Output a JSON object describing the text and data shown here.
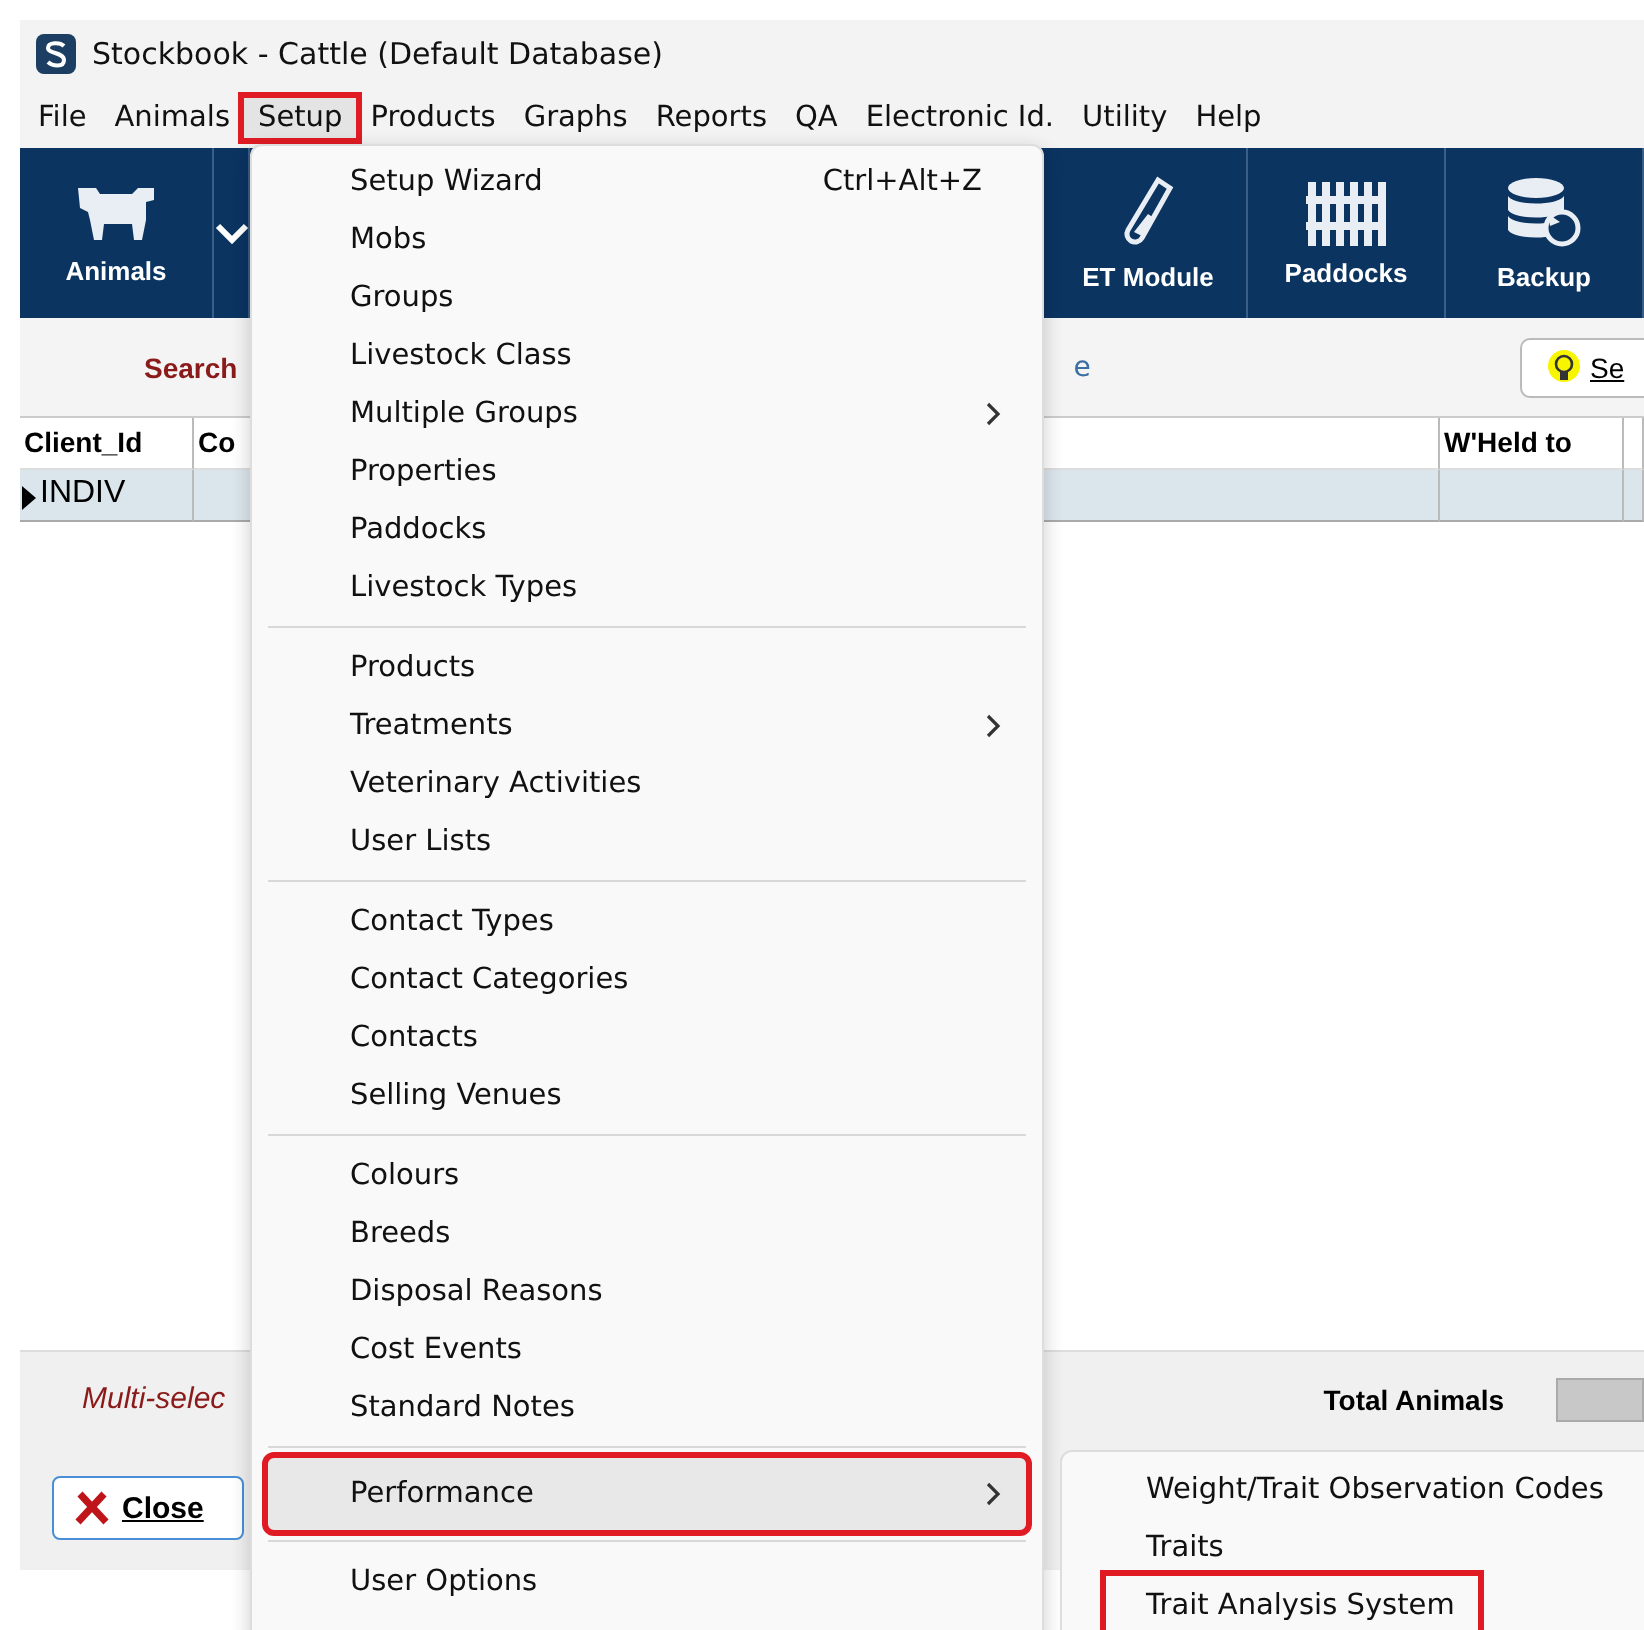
{
  "window": {
    "title": "Stockbook - Cattle (Default Database)"
  },
  "menubar": [
    {
      "label": "File",
      "selected": false,
      "annotated": false
    },
    {
      "label": "Animals",
      "selected": false,
      "annotated": false
    },
    {
      "label": "Setup",
      "selected": true,
      "annotated": true
    },
    {
      "label": "Products",
      "selected": false,
      "annotated": false
    },
    {
      "label": "Graphs",
      "selected": false,
      "annotated": false
    },
    {
      "label": "Reports",
      "selected": false,
      "annotated": false
    },
    {
      "label": "QA",
      "selected": false,
      "annotated": false
    },
    {
      "label": "Electronic Id.",
      "selected": false,
      "annotated": false
    },
    {
      "label": "Utility",
      "selected": false,
      "annotated": false
    },
    {
      "label": "Help",
      "selected": false,
      "annotated": false
    }
  ],
  "toolbar": [
    {
      "label": "Animals"
    },
    {
      "label": "ET Module"
    },
    {
      "label": "Paddocks"
    },
    {
      "label": "Backup"
    }
  ],
  "search_bar": {
    "label": "Search",
    "fragment": "e",
    "button": "Se"
  },
  "table": {
    "columns": [
      "Client_Id",
      "Co",
      "W'Held to"
    ],
    "rows": [
      {
        "client_id": "INDIV",
        "selected": true
      }
    ]
  },
  "status_bar": {
    "hint": "Multi-selec",
    "total_label": "Total Animals"
  },
  "footer": {
    "close": "Close"
  },
  "menu": {
    "sections": [
      [
        {
          "label": "Setup Wizard",
          "shortcut": "Ctrl+Alt+Z",
          "submenu": false,
          "selected": false,
          "annotated": false
        },
        {
          "label": "Mobs",
          "submenu": false,
          "selected": false,
          "annotated": false
        },
        {
          "label": "Groups",
          "submenu": false,
          "selected": false,
          "annotated": false
        },
        {
          "label": "Livestock Class",
          "submenu": false,
          "selected": false,
          "annotated": false
        },
        {
          "label": "Multiple Groups",
          "submenu": true,
          "selected": false,
          "annotated": false
        },
        {
          "label": "Properties",
          "submenu": false,
          "selected": false,
          "annotated": false
        },
        {
          "label": "Paddocks",
          "submenu": false,
          "selected": false,
          "annotated": false
        },
        {
          "label": "Livestock Types",
          "submenu": false,
          "selected": false,
          "annotated": false
        }
      ],
      [
        {
          "label": "Products",
          "submenu": false,
          "selected": false,
          "annotated": false
        },
        {
          "label": "Treatments",
          "submenu": true,
          "selected": false,
          "annotated": false
        },
        {
          "label": "Veterinary Activities",
          "submenu": false,
          "selected": false,
          "annotated": false
        },
        {
          "label": "User Lists",
          "submenu": false,
          "selected": false,
          "annotated": false
        }
      ],
      [
        {
          "label": "Contact Types",
          "submenu": false,
          "selected": false,
          "annotated": false
        },
        {
          "label": "Contact Categories",
          "submenu": false,
          "selected": false,
          "annotated": false
        },
        {
          "label": "Contacts",
          "submenu": false,
          "selected": false,
          "annotated": false
        },
        {
          "label": "Selling Venues",
          "submenu": false,
          "selected": false,
          "annotated": false
        }
      ],
      [
        {
          "label": "Colours",
          "submenu": false,
          "selected": false,
          "annotated": false
        },
        {
          "label": "Breeds",
          "submenu": false,
          "selected": false,
          "annotated": false
        },
        {
          "label": "Disposal Reasons",
          "submenu": false,
          "selected": false,
          "annotated": false
        },
        {
          "label": "Cost Events",
          "submenu": false,
          "selected": false,
          "annotated": false
        },
        {
          "label": "Standard Notes",
          "submenu": false,
          "selected": false,
          "annotated": false
        }
      ],
      [
        {
          "label": "Performance",
          "submenu": true,
          "selected": true,
          "annotated": true
        }
      ],
      [
        {
          "label": "User Options",
          "submenu": false,
          "selected": false,
          "annotated": false
        }
      ]
    ]
  },
  "submenu": [
    {
      "label": "Weight/Trait Observation Codes",
      "annotated": false
    },
    {
      "label": "Traits",
      "annotated": false
    },
    {
      "label": "Trait Analysis System",
      "annotated": true
    }
  ]
}
